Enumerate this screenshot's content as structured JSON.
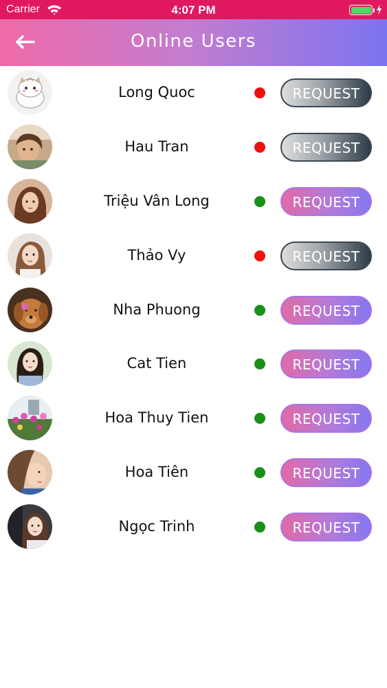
{
  "status_bar": {
    "carrier": "Carrier",
    "time": "4:07 PM"
  },
  "header": {
    "title": "Online Users"
  },
  "colors": {
    "online": "#1a8f1a",
    "offline": "#ee1111",
    "status_bar_bg": "#e0185f"
  },
  "users": [
    {
      "name": "Long Quoc",
      "online": false,
      "request_label": "REQUEST",
      "button_style": "grey"
    },
    {
      "name": "Hau Tran",
      "online": false,
      "request_label": "REQUEST",
      "button_style": "grey"
    },
    {
      "name": "Triệu Vân Long",
      "online": true,
      "request_label": "REQUEST",
      "button_style": "pink"
    },
    {
      "name": "Thảo Vy",
      "online": false,
      "request_label": "REQUEST",
      "button_style": "grey"
    },
    {
      "name": "Nha Phuong",
      "online": true,
      "request_label": "REQUEST",
      "button_style": "pink"
    },
    {
      "name": "Cat Tien",
      "online": true,
      "request_label": "REQUEST",
      "button_style": "pink"
    },
    {
      "name": "Hoa Thuy Tien",
      "online": true,
      "request_label": "REQUEST",
      "button_style": "pink"
    },
    {
      "name": "Hoa Tiên",
      "online": true,
      "request_label": "REQUEST",
      "button_style": "pink"
    },
    {
      "name": "Ngọc Trinh",
      "online": true,
      "request_label": "REQUEST",
      "button_style": "pink"
    }
  ]
}
